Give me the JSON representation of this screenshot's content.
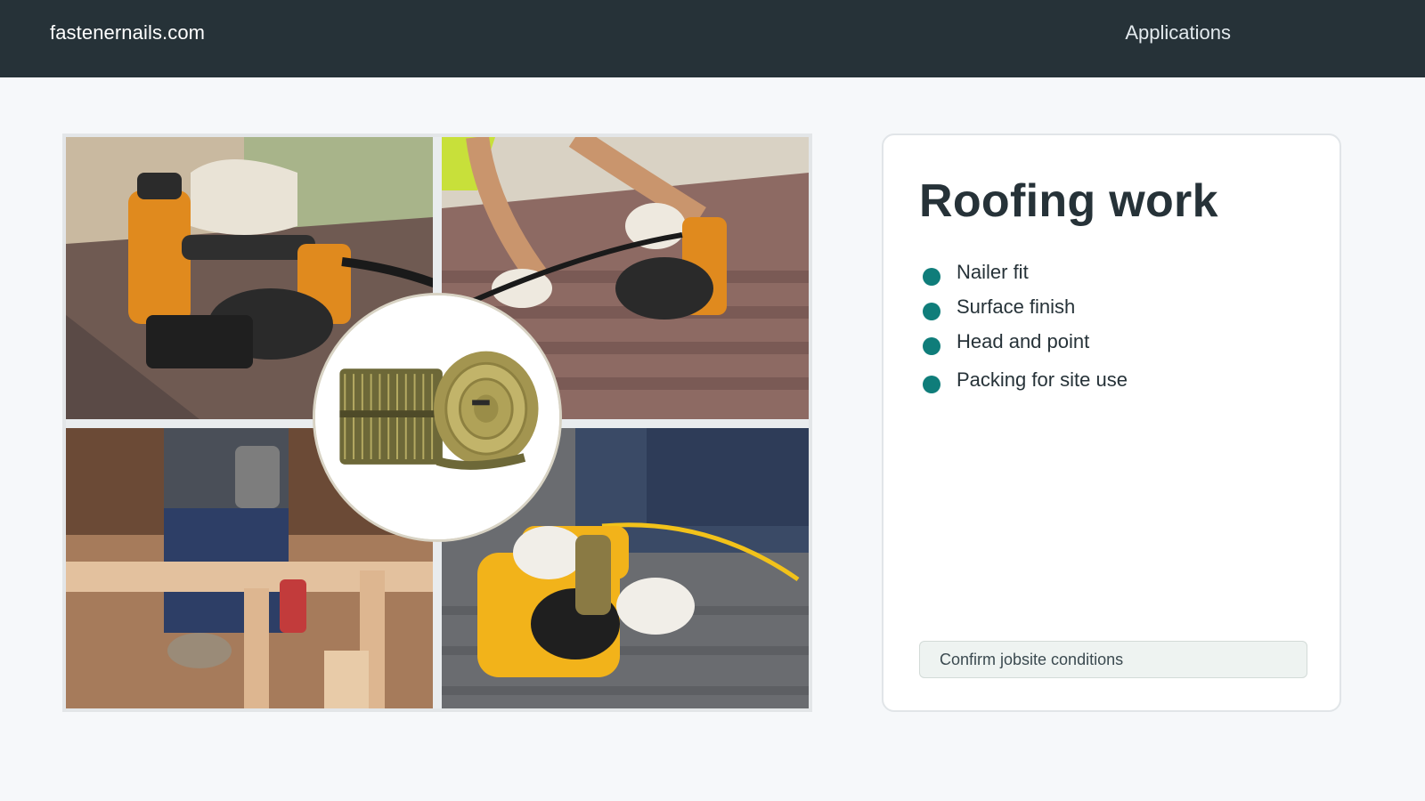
{
  "header": {
    "brand": "fastenernails.com",
    "nav_link": "Applications",
    "background": "#263238"
  },
  "collage": {
    "panels": [
      {
        "name": "roofing-nailer-shingles-photo"
      },
      {
        "name": "roofer-nailing-shingles-photo"
      },
      {
        "name": "framing-carpenter-photo"
      },
      {
        "name": "loading-coil-nailer-photo"
      }
    ],
    "center": {
      "name": "coil-nails-product-photo"
    }
  },
  "card": {
    "title": "Roofing work",
    "features": [
      {
        "label": "Nailer fit"
      },
      {
        "label": "Surface finish"
      },
      {
        "label": "Head and point"
      },
      {
        "label": "Packing for site use"
      }
    ],
    "bullet_color": "#0f7d7a",
    "cta_label": "Confirm jobsite conditions"
  }
}
